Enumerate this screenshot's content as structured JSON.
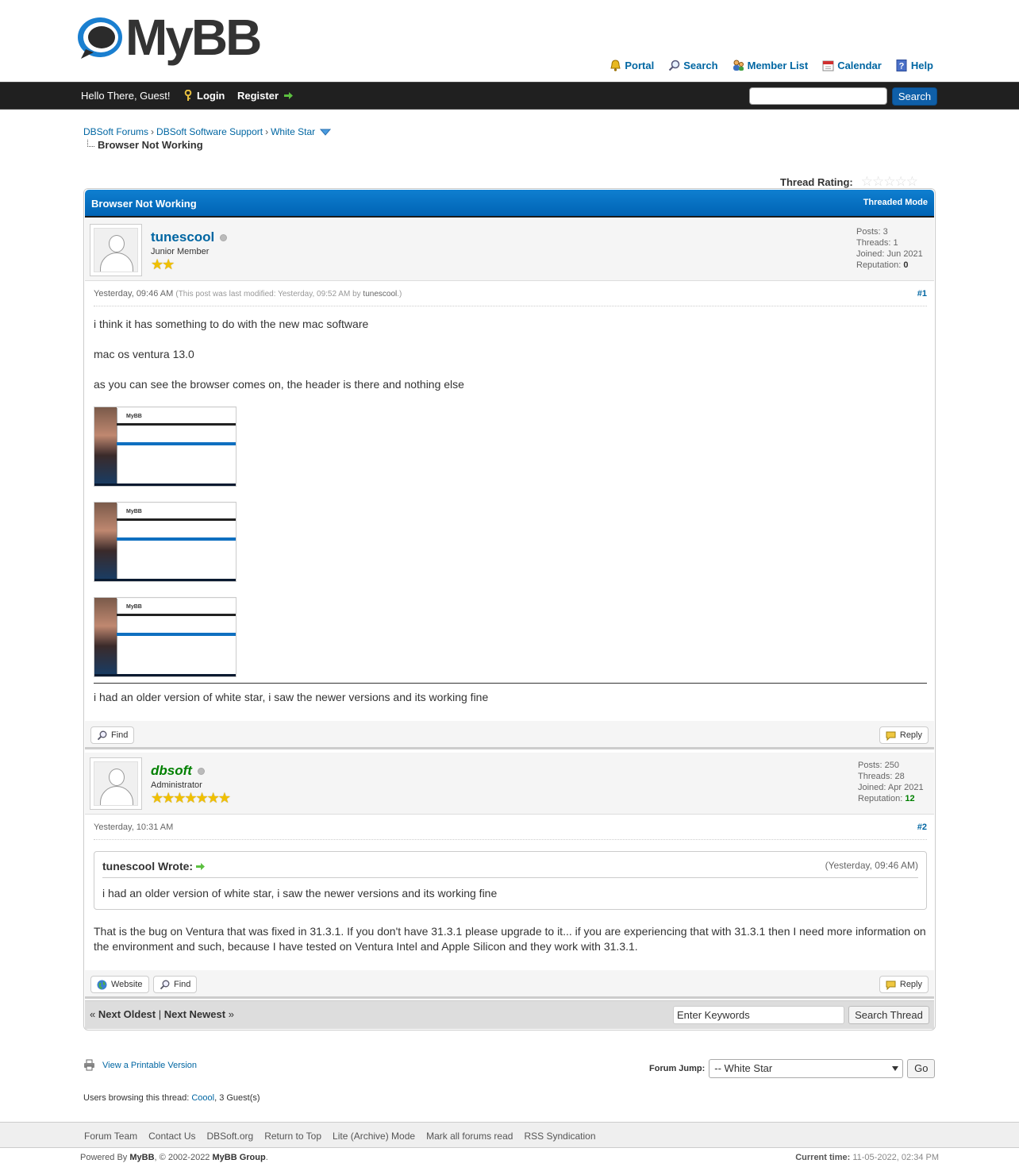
{
  "header": {
    "logo_text": "MyBB",
    "toplinks": [
      {
        "label": "Portal",
        "icon": "portal-icon"
      },
      {
        "label": "Search",
        "icon": "search-icon"
      },
      {
        "label": "Member List",
        "icon": "members-icon"
      },
      {
        "label": "Calendar",
        "icon": "calendar-icon"
      },
      {
        "label": "Help",
        "icon": "help-icon"
      }
    ]
  },
  "panel": {
    "greeting": "Hello There, Guest!",
    "login": "Login",
    "register": "Register",
    "search_value": "",
    "search_button": "Search"
  },
  "breadcrumb": {
    "items": [
      "DBSoft Forums",
      "DBSoft Software Support",
      "White Star"
    ],
    "current": "Browser Not Working"
  },
  "rating": {
    "label": "Thread Rating:",
    "value": 0,
    "max": 5
  },
  "thread": {
    "title": "Browser Not Working",
    "mode": "Threaded Mode",
    "colors": {
      "header": "#0f7fd0",
      "admin_name": "#008000"
    }
  },
  "posts": [
    {
      "author": "tunescool",
      "user_title": "Junior Member",
      "stars": "★★",
      "stats": {
        "posts": "Posts: 3",
        "threads": "Threads: 1",
        "joined": "Joined: Jun 2021",
        "reputation_label": "Reputation:",
        "reputation": "0"
      },
      "date": "Yesterday, 09:46 AM",
      "modified_prefix": "(This post was last modified: Yesterday, 09:52 AM by",
      "modified_by": "tunescool",
      "modified_suffix": ".)",
      "number": "#1",
      "paragraphs": [
        "i think it has something to do with the new mac software",
        "mac os ventura 13.0",
        "as you can see the browser comes on, the header is there and nothing else"
      ],
      "image_logo": "MyBB",
      "signature": "i had an older version of white star, i saw the newer versions and its working fine",
      "buttons": {
        "find": "Find",
        "reply": "Reply"
      }
    },
    {
      "author": "dbsoft",
      "user_title": "Administrator",
      "stars": "★★★★★★★",
      "stats": {
        "posts": "Posts: 250",
        "threads": "Threads: 28",
        "joined": "Joined: Apr 2021",
        "reputation_label": "Reputation:",
        "reputation": "12"
      },
      "date": "Yesterday, 10:31 AM",
      "number": "#2",
      "quote": {
        "header": "tunescool Wrote:",
        "date": "(Yesterday, 09:46 AM)",
        "text": "i had an older version of white star, i saw the newer versions and its working fine"
      },
      "text": "That is the bug on Ventura that was fixed in 31.3.1. If you don't have 31.3.1 please upgrade to it... if you are experiencing that with 31.3.1 then I need more information on the environment and such, because I have tested on Ventura Intel and Apple Silicon and they work with 31.3.1.",
      "buttons": {
        "website": "Website",
        "find": "Find",
        "reply": "Reply"
      }
    }
  ],
  "thread_footer": {
    "prefix": "«",
    "next_oldest": "Next Oldest",
    "divider": "|",
    "next_newest": "Next Newest",
    "suffix": "»",
    "keywords_value": "Enter Keywords",
    "search_thread": "Search Thread"
  },
  "below": {
    "printable": "View a Printable Version",
    "forum_jump_label": "Forum Jump:",
    "forum_jump_value": "-- White Star",
    "go": "Go",
    "browsing_prefix": "Users browsing this thread:",
    "browsing_user": "Coool",
    "browsing_suffix": ", 3 Guest(s)"
  },
  "footer": {
    "links": [
      "Forum Team",
      "Contact Us",
      "DBSoft.org",
      "Return to Top",
      "Lite (Archive) Mode",
      "Mark all forums read",
      "RSS Syndication"
    ],
    "powered_prefix": "Powered By",
    "powered_mybb": "MyBB",
    "powered_years": ", © 2002-2022",
    "powered_group": "MyBB Group",
    "powered_end": ".",
    "time_label": "Current time:",
    "time_value": "11-05-2022, 02:34 PM"
  }
}
